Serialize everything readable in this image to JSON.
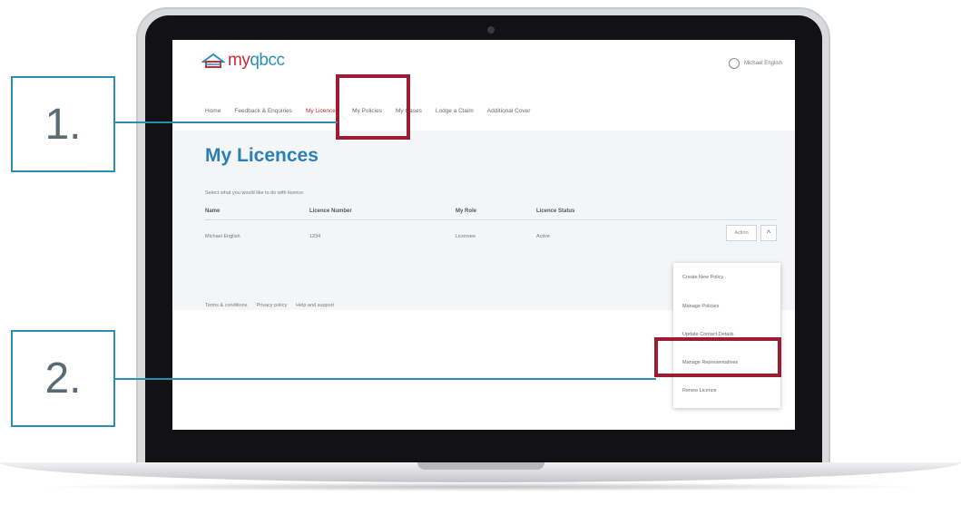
{
  "app": {
    "logo_text_a": "my",
    "logo_text_b": "qbcc",
    "account_name": "Michael English"
  },
  "nav": {
    "items": [
      "Home",
      "Feedback & Enquiries",
      "My Licences",
      "My Policies",
      "My Cases",
      "Lodge a Claim",
      "Additional Cover"
    ],
    "active": "My Licences"
  },
  "page": {
    "title": "My Licences",
    "subtitle": "Select what you would like to do with licence"
  },
  "table": {
    "headers": [
      "Name",
      "Licence Number",
      "My Role",
      "Licence Status"
    ],
    "rows": [
      [
        "Michael English",
        "1234",
        "Licensee",
        "Active"
      ]
    ],
    "action_label": "Action",
    "toggle_label": "^"
  },
  "menu": {
    "items": [
      "Create New Policy",
      "Manage Policies",
      "Update Contact Details",
      "Manage Representatives",
      "Renew Licence"
    ]
  },
  "footer": {
    "links": [
      "Terms & conditions",
      "Privacy policy",
      "Help and support"
    ]
  },
  "callouts": {
    "one": "1.",
    "two": "2."
  },
  "colors": {
    "accent_red": "#c72c3b",
    "brand_blue": "#2a7fb5",
    "highlight": "#9b1c33",
    "callout_line": "#2a8fae"
  }
}
